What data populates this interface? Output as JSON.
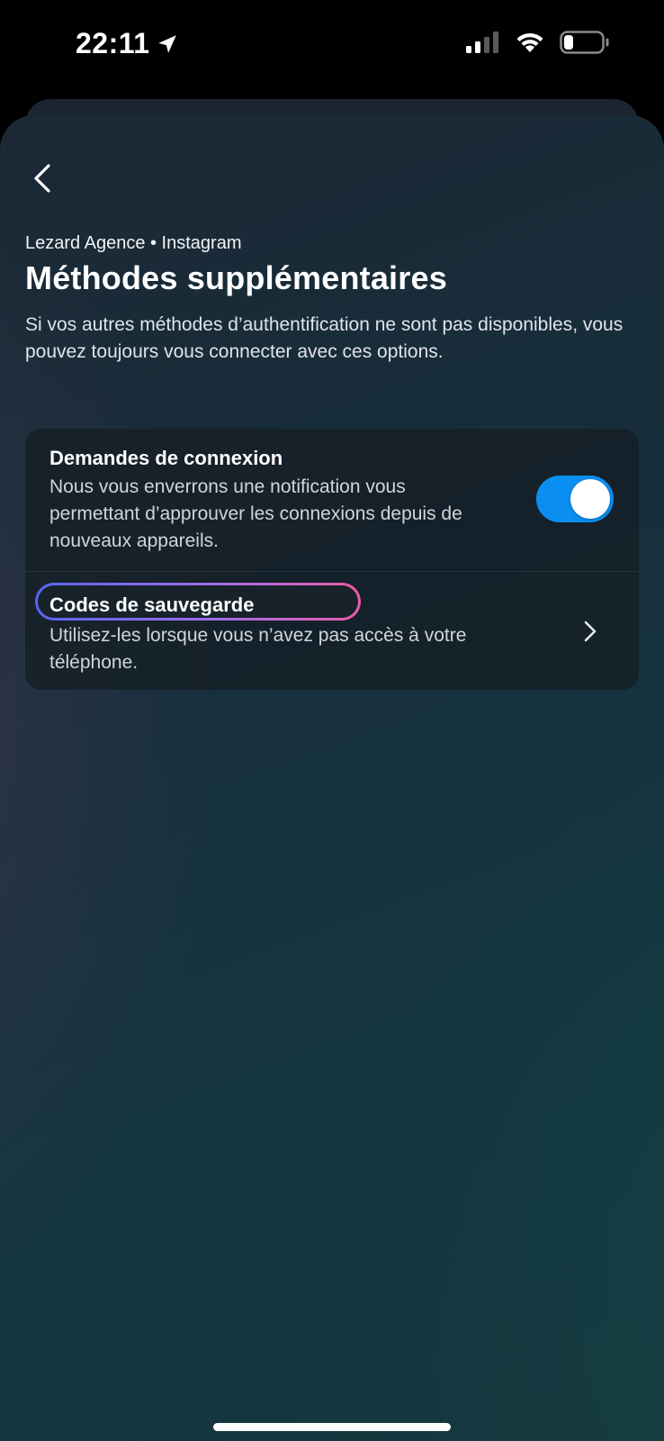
{
  "status_bar": {
    "time": "22:11",
    "battery_level_percent": 25
  },
  "header": {
    "account_line": "Lezard Agence • Instagram",
    "title": "Méthodes supplémentaires",
    "description": "Si vos autres méthodes d’authentification ne sont pas disponibles, vous pouvez toujours vous connecter avec ces options."
  },
  "options": [
    {
      "title": "Demandes de connexion",
      "description": "Nous vous enverrons une notification vous permettant d’approuver les connexions depuis de nouveaux appareils.",
      "control": "toggle",
      "enabled": true
    },
    {
      "title": "Codes de sauvegarde",
      "description": "Utilisez-les lorsque vous n’avez pas accès à votre téléphone.",
      "control": "chevron-right-icon",
      "highlighted": true
    }
  ],
  "colors": {
    "toggle_on": "#0a8ff0",
    "highlight_start": "#5865f2",
    "highlight_end": "#ee5aa8",
    "background": "#16303d"
  }
}
